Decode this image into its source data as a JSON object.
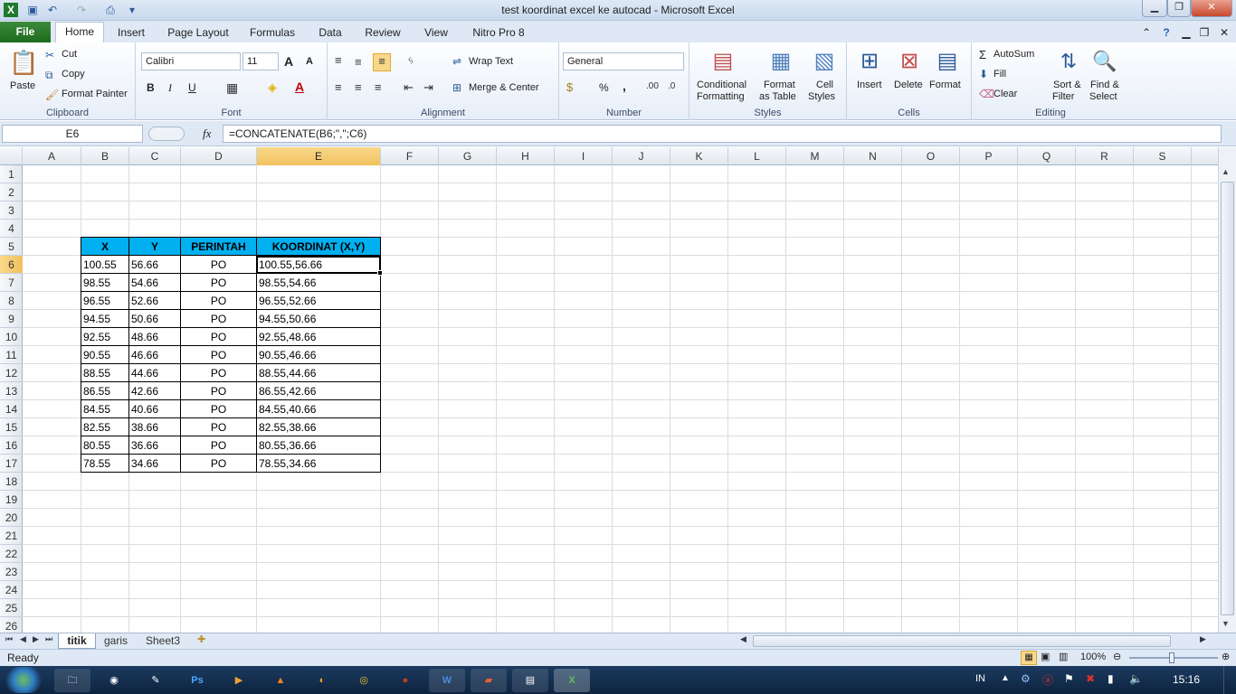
{
  "window": {
    "title": "test koordinat excel ke autocad  -  Microsoft Excel"
  },
  "ribbon_tabs": [
    "File",
    "Home",
    "Insert",
    "Page Layout",
    "Formulas",
    "Data",
    "Review",
    "View",
    "Nitro Pro 8"
  ],
  "clipboard": {
    "paste": "Paste",
    "cut": "Cut",
    "copy": "Copy",
    "format_painter": "Format Painter",
    "label": "Clipboard"
  },
  "font": {
    "name": "Calibri",
    "size": "11",
    "bold": "B",
    "italic": "I",
    "underline": "U",
    "label": "Font"
  },
  "alignment": {
    "wrap_text": "Wrap Text",
    "merge_center": "Merge & Center",
    "label": "Alignment"
  },
  "number": {
    "format": "General",
    "percent": "%",
    "comma": ",",
    "label": "Number"
  },
  "styles": {
    "conditional": "Conditional",
    "formatting": "Formatting",
    "format_as": "Format",
    "as_table": "as Table",
    "cell": "Cell",
    "cell_styles": "Styles",
    "label": "Styles"
  },
  "cells": {
    "insert": "Insert",
    "delete": "Delete",
    "format": "Format",
    "label": "Cells"
  },
  "editing": {
    "autosum": "AutoSum",
    "fill": "Fill",
    "clear": "Clear",
    "sort": "Sort &",
    "filter": "Filter",
    "find": "Find &",
    "select": "Select",
    "label": "Editing"
  },
  "formula_bar": {
    "name_box": "E6",
    "fx": "fx",
    "formula": "=CONCATENATE(B6;\",\";C6)"
  },
  "columns": [
    "A",
    "B",
    "C",
    "D",
    "E",
    "F",
    "G",
    "H",
    "I",
    "J",
    "K",
    "L",
    "M",
    "N",
    "O",
    "P",
    "Q",
    "R",
    "S"
  ],
  "rows": [
    "1",
    "2",
    "3",
    "4",
    "5",
    "6",
    "7",
    "8",
    "9",
    "10",
    "11",
    "12",
    "13",
    "14",
    "15",
    "16",
    "17",
    "18",
    "19",
    "20",
    "21",
    "22",
    "23",
    "24",
    "25",
    "26"
  ],
  "table": {
    "headers": [
      "X",
      "Y",
      "PERINTAH",
      "KOORDINAT (X,Y)"
    ],
    "rows": [
      [
        "100.55",
        "56.66",
        "PO",
        "100.55,56.66"
      ],
      [
        "98.55",
        "54.66",
        "PO",
        "98.55,54.66"
      ],
      [
        "96.55",
        "52.66",
        "PO",
        "96.55,52.66"
      ],
      [
        "94.55",
        "50.66",
        "PO",
        "94.55,50.66"
      ],
      [
        "92.55",
        "48.66",
        "PO",
        "92.55,48.66"
      ],
      [
        "90.55",
        "46.66",
        "PO",
        "90.55,46.66"
      ],
      [
        "88.55",
        "44.66",
        "PO",
        "88.55,44.66"
      ],
      [
        "86.55",
        "42.66",
        "PO",
        "86.55,42.66"
      ],
      [
        "84.55",
        "40.66",
        "PO",
        "84.55,40.66"
      ],
      [
        "82.55",
        "38.66",
        "PO",
        "82.55,38.66"
      ],
      [
        "80.55",
        "36.66",
        "PO",
        "80.55,36.66"
      ],
      [
        "78.55",
        "34.66",
        "PO",
        "78.55,34.66"
      ]
    ]
  },
  "sheets": [
    "titik",
    "garis",
    "Sheet3"
  ],
  "status": {
    "ready": "Ready",
    "zoom": "100%"
  },
  "taskbar": {
    "lang": "IN",
    "time": "15:16"
  },
  "colors": {
    "header_fill": "#00b0f0",
    "selected_header": "#f9d88a",
    "file_tab": "#2a7d2a"
  }
}
